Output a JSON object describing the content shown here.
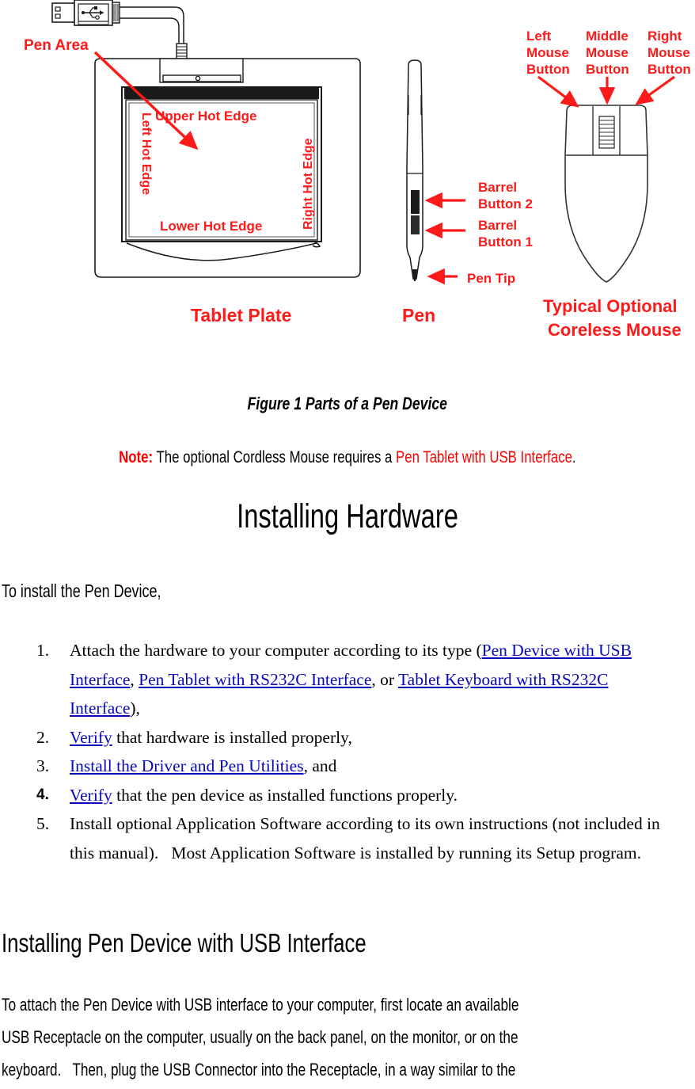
{
  "figure": {
    "labels": {
      "pen_area": "Pen Area",
      "upper_hot_edge": "Upper Hot Edge",
      "lower_hot_edge": "Lower Hot Edge",
      "left_hot_edge": "Left Hot Edge",
      "right_hot_edge": "Right Hot Edge",
      "tablet_plate": "Tablet Plate",
      "pen": "Pen",
      "barrel_button_2": "Barrel",
      "barrel_button_2b": "Button 2",
      "barrel_button_1": "Barrel",
      "barrel_button_1b": "Button 1",
      "pen_tip": "Pen Tip",
      "left_mouse_button_1": "Left",
      "left_mouse_button_2": "Mouse",
      "left_mouse_button_3": "Button",
      "middle_mouse_button_1": "Middle",
      "middle_mouse_button_2": "Mouse",
      "middle_mouse_button_3": "Button",
      "right_mouse_button_1": "Right",
      "right_mouse_button_2": "Mouse",
      "right_mouse_button_3": "Button",
      "coreless_mouse_1": "Typical Optional",
      "coreless_mouse_2": "Coreless Mouse"
    },
    "label_color": "#ff1a1a",
    "caption": "Figure 1 Parts of a Pen Device"
  },
  "note": {
    "keyword": "Note:",
    "text_before": " The optional Cordless Mouse requires a ",
    "highlight": "Pen Tablet with USB Interface",
    "text_after": ".",
    "keyword_color": "#ff0000",
    "highlight_color": "#ff0000"
  },
  "headings": {
    "h1": "Installing Hardware",
    "h2": "Installing Pen Device with USB Interface"
  },
  "lead_in": "To install the Pen Device,",
  "steps": [
    {
      "number": "1.",
      "number_style": "serif",
      "parts": [
        {
          "text": "Attach the hardware to your computer according to its type (",
          "link": false
        },
        {
          "text": "Pen Device with USB Interface",
          "link": true
        },
        {
          "text": ", ",
          "link": false
        },
        {
          "text": "Pen Tablet with RS232C Interface",
          "link": true
        },
        {
          "text": ", or ",
          "link": false
        },
        {
          "text": "Tablet Keyboard with RS232C Interface",
          "link": true
        },
        {
          "text": "),",
          "link": false
        }
      ]
    },
    {
      "number": "2.",
      "number_style": "serif",
      "parts": [
        {
          "text": "Verify",
          "link": true
        },
        {
          "text": " that hardware is installed properly,",
          "link": false
        }
      ]
    },
    {
      "number": "3.",
      "number_style": "serif",
      "parts": [
        {
          "text": "Install the Driver and Pen Utilities",
          "link": true
        },
        {
          "text": ", and",
          "link": false
        }
      ]
    },
    {
      "number": "4.",
      "number_style": "sans-bold",
      "parts": [
        {
          "text": "Verify",
          "link": true
        },
        {
          "text": " that the pen device as installed functions properly.",
          "link": false
        }
      ]
    },
    {
      "number": "5.",
      "number_style": "serif",
      "parts": [
        {
          "text": "Install optional Application Software according to its own instructions (not included in this manual).   Most Application Software is installed by running its Setup program.",
          "link": false
        }
      ]
    }
  ],
  "link_color": "#0808bb",
  "body_paragraph": {
    "lines": [
      "To attach the Pen Device with USB interface to your computer, first locate an available",
      "USB Receptacle on the computer, usually on the back panel, on the monitor, or on the",
      "keyboard.   Then, plug the USB Connector into the Receptacle, in a way similar to the"
    ]
  }
}
